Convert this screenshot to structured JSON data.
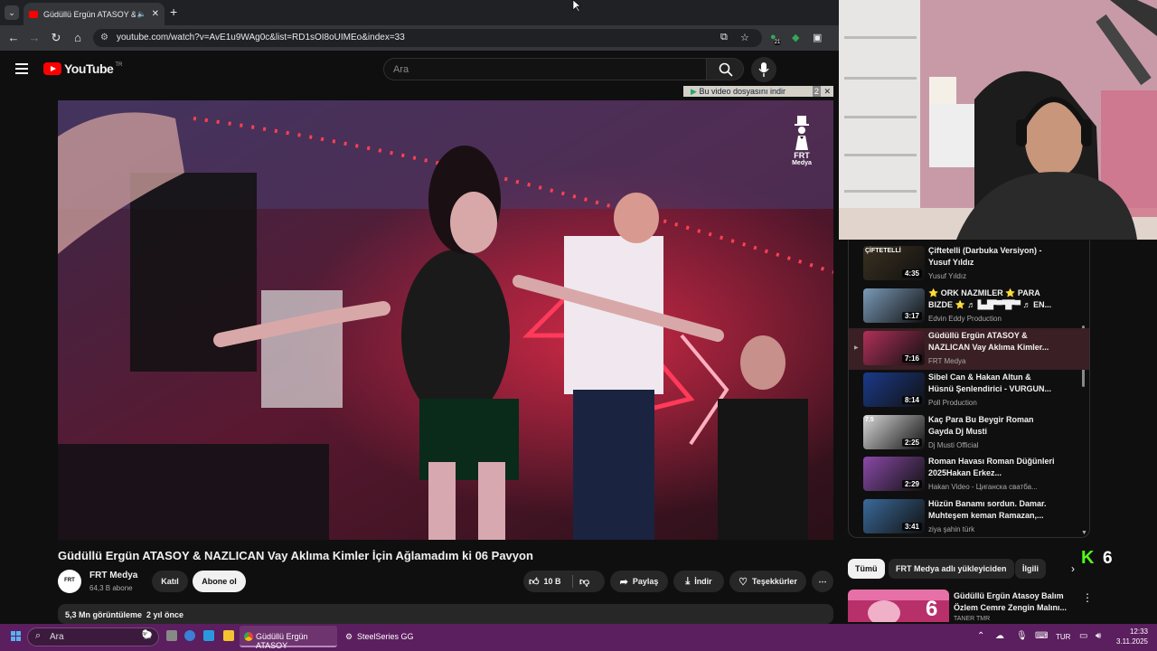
{
  "browser": {
    "tab_title": "Güdüllü Ergün ATASOY & N",
    "url": "youtube.com/watch?v=AvE1u9WAg0c&list=RD1sOI8oUIMEo&index=33",
    "ext_badge": "21"
  },
  "youtube": {
    "logo_text": "YouTube",
    "logo_country": "TR",
    "search_placeholder": "Ara",
    "download_banner": "Bu video dosyasını indir",
    "download_banner_num": "2",
    "video_watermark_line1": "FRT",
    "video_watermark_line2": "Medya",
    "video_title": "Güdüllü Ergün ATASOY & NAZLICAN Vay Aklıma Kimler İçin Ağlamadım ki 06 Pavyon",
    "channel": {
      "name": "FRT Medya",
      "subs": "64,3 B abone",
      "avatar_text": "FRT"
    },
    "actions": {
      "join": "Katıl",
      "subscribe": "Abone ol",
      "likes": "10 B",
      "share": "Paylaş",
      "download": "İndir",
      "thanks": "Teşekkürler"
    },
    "stats": "5,3 Mn görüntüleme  2 yıl önce"
  },
  "playlist": [
    {
      "title": "Çiftetelli (Darbuka Versiyon) - Yusuf Yıldız",
      "channel": "Yusuf Yıldız",
      "duration": "4:35",
      "thumb_text": "ÇİFTETELLİ",
      "color": "#3a3020"
    },
    {
      "title": "⭐ ORK NAZMILER ⭐ PARA BIZDE ⭐ ♬ ▙▟▛▀▜▛▀ ♬ EN...",
      "channel": "Edvin Eddy Production",
      "duration": "3:17",
      "thumb_text": "",
      "color": "#7a9ab8"
    },
    {
      "title": "Güdüllü Ergün ATASOY & NAZLICAN Vay Aklıma Kimler...",
      "channel": "FRT Medya",
      "duration": "7:16",
      "thumb_text": "",
      "color": "#b0305a",
      "active": true
    },
    {
      "title": "Sibel Can & Hakan Altun & Hüsnü Şenlendirici - VURGUN...",
      "channel": "Poll Production",
      "duration": "8:14",
      "thumb_text": "",
      "color": "#1a3a8a"
    },
    {
      "title": "Kaç Para Bu Beygir Roman Gayda Dj Musti",
      "channel": "Dj Musti Official",
      "duration": "2:25",
      "thumb_text": "7.5",
      "color": "#d8d8d8"
    },
    {
      "title": "Roman Havası Roman Düğünleri 2025Hakan Erkez...",
      "channel": "Hakan Video - Циганска сватба...",
      "duration": "2:29",
      "thumb_text": "",
      "color": "#8a4aa8"
    },
    {
      "title": "Hüzün Banamı sordun. Damar. Muhteşem keman Ramazan,...",
      "channel": "ziya şahin türk",
      "duration": "3:41",
      "thumb_text": "",
      "color": "#3a6a9a"
    }
  ],
  "chips": [
    {
      "label": "Tümü",
      "selected": true
    },
    {
      "label": "FRT Medya adlı yükleyiciden",
      "selected": false
    },
    {
      "label": "İlgili",
      "selected": false
    }
  ],
  "kick": {
    "logo": "K",
    "count": "6"
  },
  "recommended": {
    "title": "Güdüllü Ergün Atasoy Balım Özlem Cemre Zengin Malını...",
    "channel": "TANER TMR",
    "thumb_num": "6"
  },
  "taskbar": {
    "search_placeholder": "Ara",
    "chrome_label": "Güdüllü Ergün ATASOY",
    "steel_label": "SteelSeries GG",
    "lang": "TUR",
    "time": "12:33",
    "date": "3.11.2025"
  },
  "colors": {
    "accent": "#ff0000",
    "taskbar": "#5b1e5e",
    "kick": "#53fc18"
  }
}
